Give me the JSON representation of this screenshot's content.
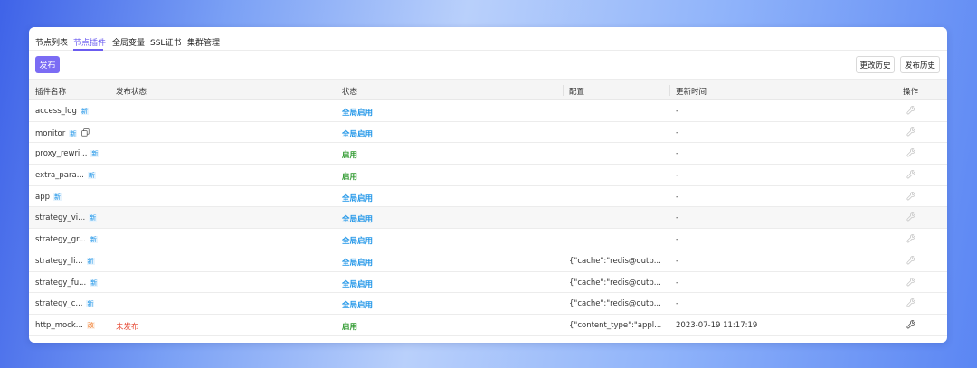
{
  "tabs": [
    "节点列表",
    "节点插件",
    "全局变量",
    "SSL证书",
    "集群管理"
  ],
  "toolbar": {
    "publish": "发布",
    "change_history": "更改历史",
    "publish_history": "发布历史"
  },
  "columns": {
    "name": "插件名称",
    "publish_status": "发布状态",
    "status": "状态",
    "config": "配置",
    "updated": "更新时间",
    "actions": "操作"
  },
  "rows": [
    {
      "name": "access_log",
      "tag": "新",
      "pub": "",
      "status": "全局启用",
      "config": "",
      "time": "-"
    },
    {
      "name": "monitor",
      "tag": "新",
      "pub": "",
      "status": "全局启用",
      "config": "",
      "time": "-"
    },
    {
      "name": "proxy_rewri...",
      "tag": "新",
      "pub": "",
      "status": "启用",
      "config": "",
      "time": "-"
    },
    {
      "name": "extra_para...",
      "tag": "新",
      "pub": "",
      "status": "启用",
      "config": "",
      "time": "-"
    },
    {
      "name": "app",
      "tag": "新",
      "pub": "",
      "status": "全局启用",
      "config": "",
      "time": "-"
    },
    {
      "name": "strategy_vi...",
      "tag": "新",
      "pub": "",
      "status": "全局启用",
      "config": "",
      "time": "-"
    },
    {
      "name": "strategy_gr...",
      "tag": "新",
      "pub": "",
      "status": "全局启用",
      "config": "",
      "time": "-"
    },
    {
      "name": "strategy_li...",
      "tag": "新",
      "pub": "",
      "status": "全局启用",
      "config": "{\"cache\":\"redis@outp...",
      "time": "-"
    },
    {
      "name": "strategy_fu...",
      "tag": "新",
      "pub": "",
      "status": "全局启用",
      "config": "{\"cache\":\"redis@outp...",
      "time": "-"
    },
    {
      "name": "strategy_c...",
      "tag": "新",
      "pub": "",
      "status": "全局启用",
      "config": "{\"cache\":\"redis@outp...",
      "time": "-"
    },
    {
      "name": "http_mock...",
      "tag": "改",
      "pub": "未发布",
      "status": "启用",
      "config": "{\"content_type\":\"appl...",
      "time": "2023-07-19 11:17:19"
    }
  ]
}
